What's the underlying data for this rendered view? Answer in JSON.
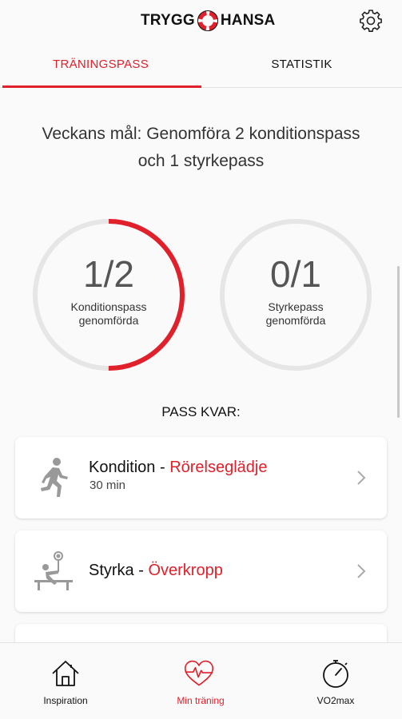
{
  "header": {
    "logo_left": "TRYGG",
    "logo_right": "HANSA",
    "settings_icon": "gear-icon"
  },
  "tabs": [
    {
      "label": "TRÄNINGSPASS",
      "active": true
    },
    {
      "label": "STATISTIK",
      "active": false
    }
  ],
  "goal": {
    "text": "Veckans mål: Genomföra 2 konditionspass och 1 styrkepass"
  },
  "progress": [
    {
      "count": "1/2",
      "label_line1": "Konditionspass",
      "label_line2": "genomförda",
      "completed": 1,
      "total": 2
    },
    {
      "count": "0/1",
      "label_line1": "Styrkepass",
      "label_line2": "genomförda",
      "completed": 0,
      "total": 1
    }
  ],
  "remaining_heading": "PASS KVAR:",
  "workouts": [
    {
      "type": "Kondition",
      "separator": " - ",
      "name": "Rörelseglädje",
      "duration": "30 min",
      "icon": "running-person-icon"
    },
    {
      "type": "Styrka",
      "separator": " - ",
      "name": "Överkropp",
      "duration": "",
      "icon": "bench-press-icon"
    }
  ],
  "bottom_nav": [
    {
      "label": "Inspiration",
      "icon": "house-icon",
      "active": false
    },
    {
      "label": "Min träning",
      "icon": "heart-pulse-icon",
      "active": true
    },
    {
      "label": "VO2max",
      "icon": "stopwatch-icon",
      "active": false
    }
  ],
  "colors": {
    "accent": "#e0202b",
    "ring_track": "#e6e6e6",
    "background": "#fafafa"
  }
}
